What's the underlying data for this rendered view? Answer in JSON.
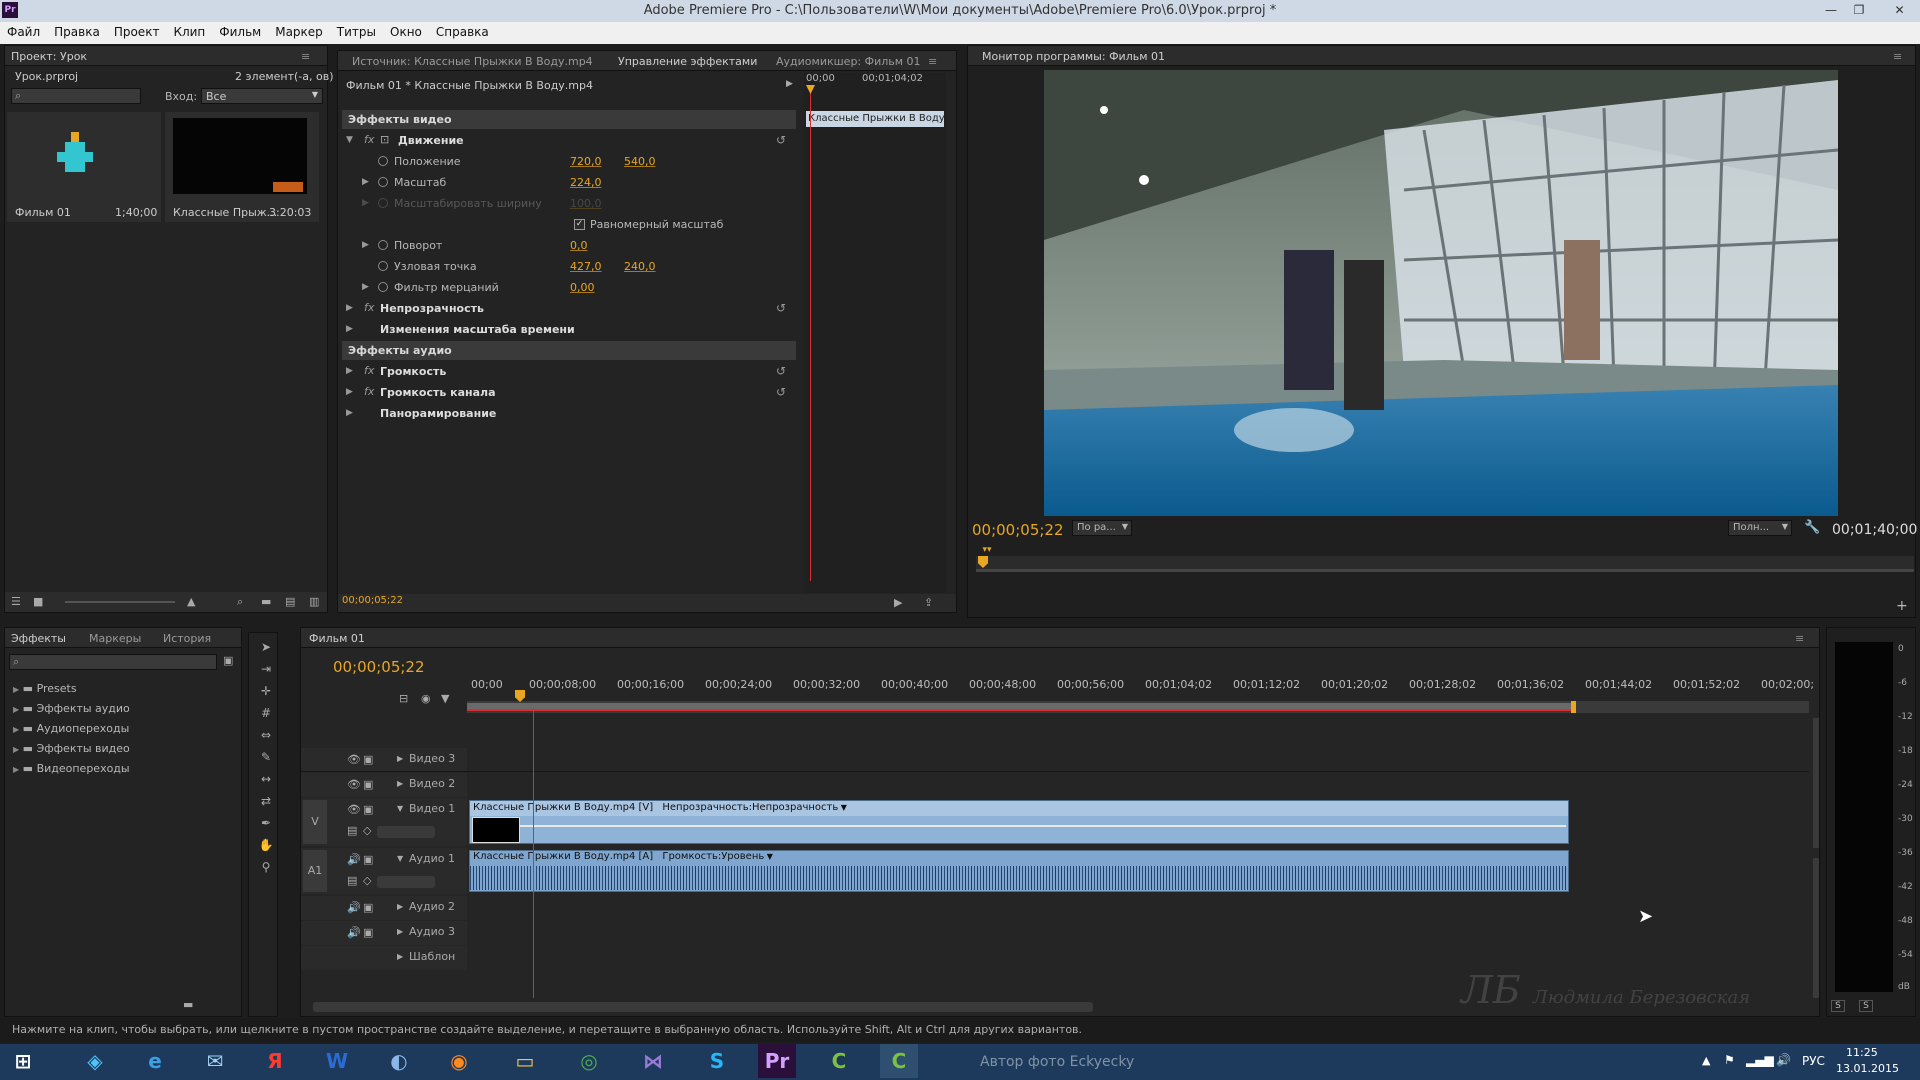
{
  "window": {
    "title": "Adobe Premiere Pro - C:\\Пользователи\\W\\Мои документы\\Adobe\\Premiere Pro\\6.0\\Урок.prproj *",
    "app_icon": "Pr"
  },
  "menu": [
    "Файл",
    "Правка",
    "Проект",
    "Клип",
    "Фильм",
    "Маркер",
    "Титры",
    "Окно",
    "Справка"
  ],
  "project": {
    "tab": "Проект: Урок",
    "file": "Урок.prproj",
    "count": "2 элемент(-а, ов)",
    "input_label": "Вход:",
    "input_value": "Все",
    "items": [
      {
        "name": "Фильм 01",
        "duration": "1;40;00"
      },
      {
        "name": "Классные Прыж...",
        "duration": "3:20:03"
      }
    ]
  },
  "source_tabs": {
    "source": "Источник: Классные Прыжки В Воду.mp4",
    "effects": "Управление эффектами",
    "mixer": "Аудиомикшер: Фильм 01"
  },
  "effect_controls": {
    "clip": "Фильм 01 * Классные Прыжки В Воду.mp4",
    "video_header": "Эффекты видео",
    "motion": "Движение",
    "position_label": "Положение",
    "position_x": "720,0",
    "position_y": "540,0",
    "scale_label": "Масштаб",
    "scale_value": "224,0",
    "scale_width_label": "Масштабировать ширину",
    "scale_width_value": "100,0",
    "uniform_label": "Равномерный масштаб",
    "rotation_label": "Поворот",
    "rotation_value": "0,0",
    "anchor_label": "Узловая точка",
    "anchor_x": "427,0",
    "anchor_y": "240,0",
    "flicker_label": "Фильтр мерцаний",
    "flicker_value": "0,00",
    "opacity": "Непрозрачность",
    "time_remap": "Изменения масштаба времени",
    "audio_header": "Эффекты аудио",
    "volume": "Громкость",
    "channel_volume": "Громкость канала",
    "panner": "Панорамирование",
    "mini_time_start": "00;00",
    "mini_time_end": "00;01;04;02",
    "mini_clip": "Классные Прыжки В Воду",
    "current_time": "00;00;05;22"
  },
  "program": {
    "tab": "Монитор программы: Фильм 01",
    "timecode": "00;00;05;22",
    "fit": "По ра...",
    "quality": "Полн...",
    "duration": "00;01;40;00"
  },
  "effects_panel": {
    "tabs": [
      "Эффекты",
      "Маркеры",
      "История"
    ],
    "items": [
      "Presets",
      "Эффекты аудио",
      "Аудиопереходы",
      "Эффекты видео",
      "Видеопереходы"
    ]
  },
  "timeline": {
    "tab": "Фильм 01",
    "timecode": "00;00;05;22",
    "ruler": [
      "00;00",
      "00;00;08;00",
      "00;00;16;00",
      "00;00;24;00",
      "00;00;32;00",
      "00;00;40;00",
      "00;00;48;00",
      "00;00;56;00",
      "00;01;04;02",
      "00;01;12;02",
      "00;01;20;02",
      "00;01;28;02",
      "00;01;36;02",
      "00;01;44;02",
      "00;01;52;02",
      "00;02;00;"
    ],
    "tracks": {
      "v3": "Видео 3",
      "v2": "Видео 2",
      "v1": "Видео 1",
      "a1": "Аудио 1",
      "a2": "Аудио 2",
      "a3": "Аудио 3",
      "master": "Шаблон"
    },
    "v_target": "V",
    "a_target": "A1",
    "video_clip": "Классные Прыжки В Воду.mp4 [V]",
    "video_fx": "Непрозрачность:Непрозрачность",
    "audio_clip": "Классные Прыжки В Воду.mp4 [A]",
    "audio_fx": "Громкость:Уровень"
  },
  "vu_scale": [
    "0",
    "-6",
    "-12",
    "-18",
    "-24",
    "-30",
    "-36",
    "-42",
    "-48",
    "-54",
    "dB"
  ],
  "vu_buttons": [
    "S",
    "S"
  ],
  "watermark": "Людмила Березовская",
  "status": "Нажмите на клип, чтобы выбрать, или щелкните в пустом пространстве создайте выделение, и перетащите в выбранную область. Используйте Shift, Alt и Ctrl для других вариантов.",
  "taskbar": {
    "lang": "РУС",
    "time": "11:25",
    "date": "13.01.2015",
    "photo_credit": "Автор фото Eckyecky"
  },
  "colors": {
    "accent": "#e8a623",
    "clip_video": "#8fb3d6",
    "clip_audio": "#7fa6cf",
    "playhead": "#d83030"
  }
}
